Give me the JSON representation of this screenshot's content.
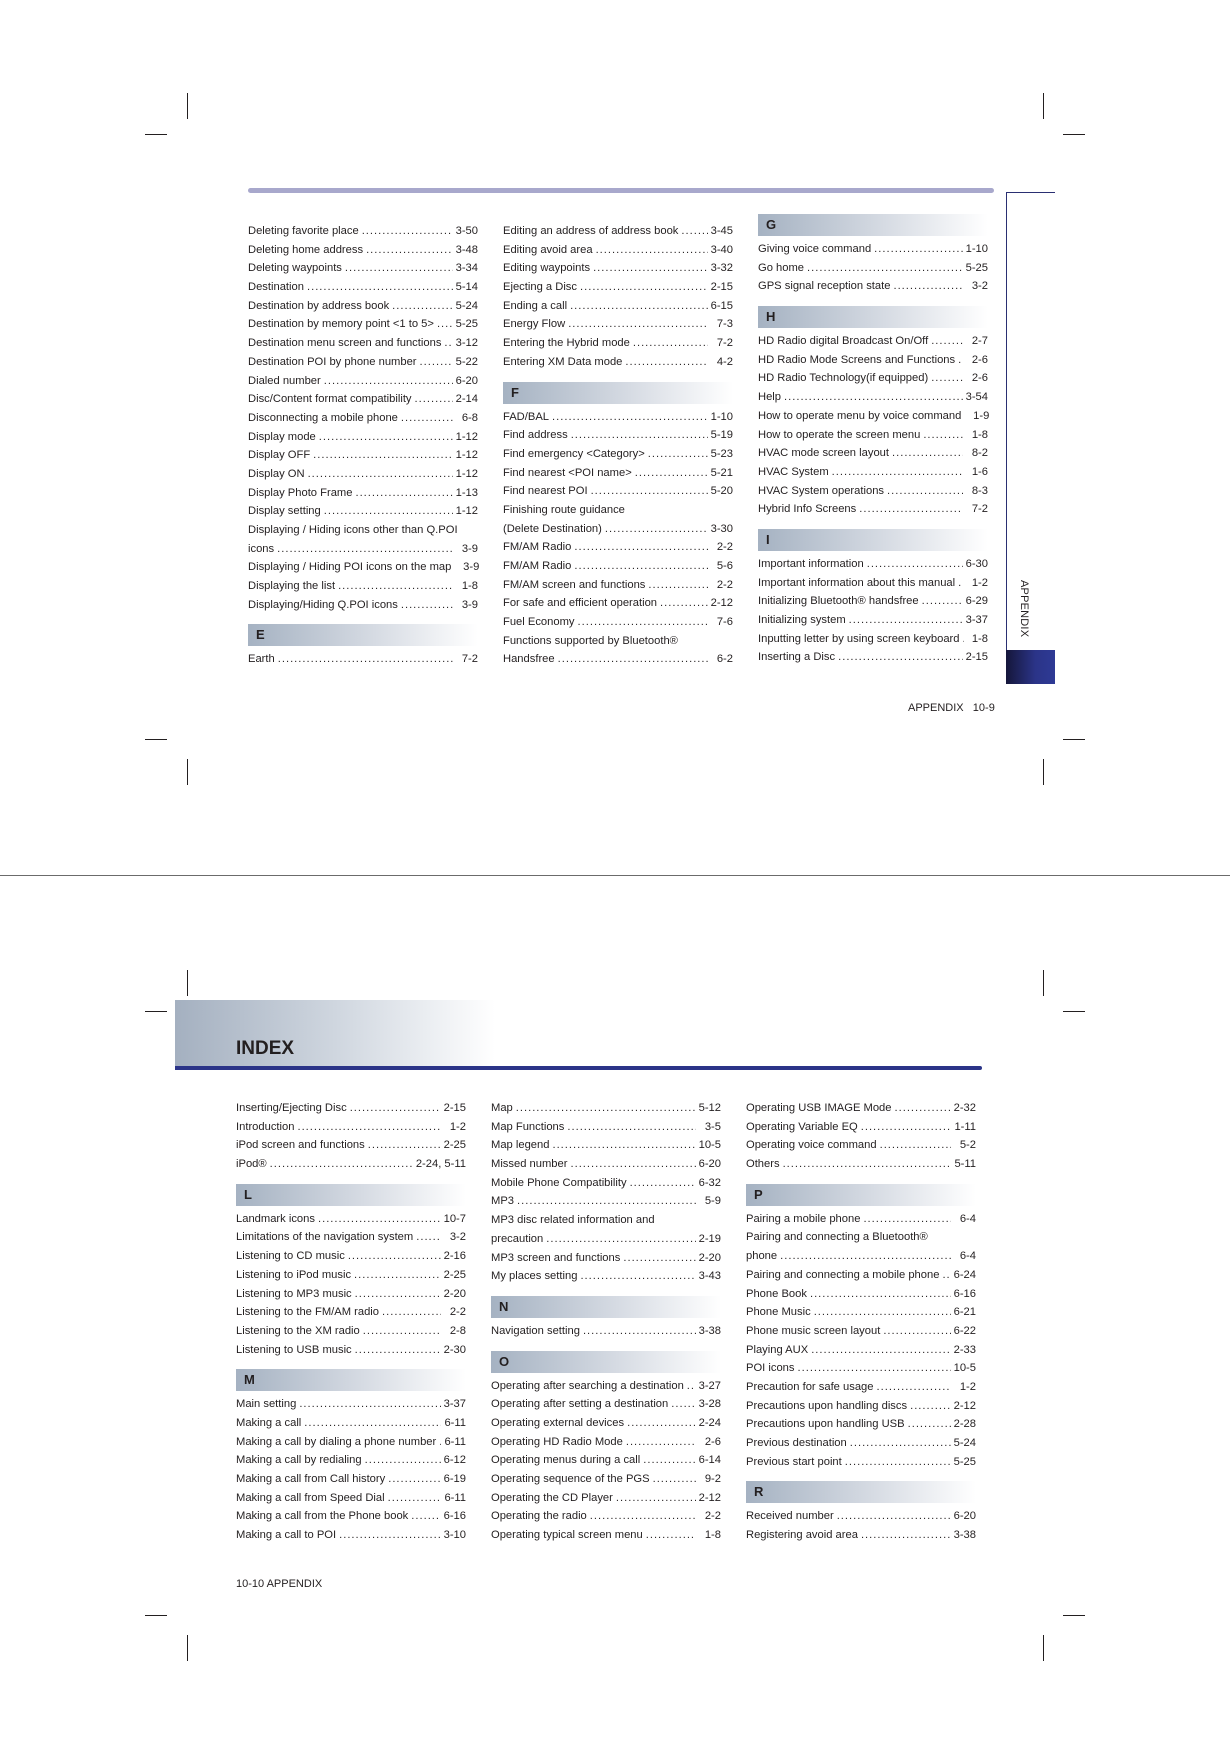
{
  "top_page": {
    "tab_label": "APPENDIX",
    "footer": "APPENDIX   10-9",
    "columns": [
      {
        "blocks": [
          {
            "entries": [
              {
                "t": "Deleting favorite place",
                "p": "3-50"
              },
              {
                "t": "Deleting home address",
                "p": "3-48"
              },
              {
                "t": "Deleting waypoints",
                "p": "3-34"
              },
              {
                "t": "Destination",
                "p": "5-14"
              },
              {
                "t": "Destination by address book",
                "p": "5-24"
              },
              {
                "t": "Destination by memory point <1 to 5>",
                "p": "5-25"
              },
              {
                "t": "Destination menu screen and functions",
                "p": "3-12"
              },
              {
                "t": "Destination POI by phone number",
                "p": "5-22"
              },
              {
                "t": "Dialed number",
                "p": "6-20"
              },
              {
                "t": "Disc/Content format compatibility",
                "p": "2-14"
              },
              {
                "t": "Disconnecting a mobile phone",
                "p": "6-8"
              },
              {
                "t": "Display mode",
                "p": "1-12"
              },
              {
                "t": "Display OFF",
                "p": "1-12"
              },
              {
                "t": "Display ON",
                "p": "1-12"
              },
              {
                "t": "Display Photo Frame",
                "p": "1-13"
              },
              {
                "t": "Display setting",
                "p": "1-12"
              },
              {
                "t": "Displaying / Hiding icons other than Q.POI",
                "p": ""
              },
              {
                "t": "icons",
                "p": "3-9"
              },
              {
                "t": "Displaying / Hiding POI icons on the map",
                "p": "3-9"
              },
              {
                "t": "Displaying the list",
                "p": "1-8"
              },
              {
                "t": "Displaying/Hiding Q.POI icons",
                "p": "3-9"
              }
            ]
          },
          {
            "letter": "E",
            "entries": [
              {
                "t": "Earth",
                "p": "7-2"
              }
            ]
          }
        ]
      },
      {
        "blocks": [
          {
            "entries": [
              {
                "t": "Editing an address of address book",
                "p": "3-45"
              },
              {
                "t": "Editing avoid area",
                "p": "3-40"
              },
              {
                "t": "Editing waypoints",
                "p": "3-32"
              },
              {
                "t": "Ejecting a Disc",
                "p": "2-15"
              },
              {
                "t": "Ending a call",
                "p": "6-15"
              },
              {
                "t": "Energy Flow",
                "p": "7-3"
              },
              {
                "t": "Entering the Hybrid mode",
                "p": "7-2"
              },
              {
                "t": "Entering XM Data mode",
                "p": "4-2"
              }
            ]
          },
          {
            "letter": "F",
            "entries": [
              {
                "t": "FAD/BAL",
                "p": "1-10"
              },
              {
                "t": "Find address",
                "p": "5-19"
              },
              {
                "t": "Find emergency <Category>",
                "p": "5-23"
              },
              {
                "t": "Find nearest <POI name>",
                "p": "5-21"
              },
              {
                "t": "Find nearest POI",
                "p": "5-20"
              },
              {
                "t": "Finishing route guidance",
                "p": ""
              },
              {
                "t": "(Delete Destination)",
                "p": "3-30"
              },
              {
                "t": "FM/AM Radio",
                "p": "2-2"
              },
              {
                "t": "FM/AM Radio",
                "p": "5-6"
              },
              {
                "t": "FM/AM screen and functions",
                "p": "2-2"
              },
              {
                "t": "For safe and efficient operation",
                "p": "2-12"
              },
              {
                "t": "Fuel Economy",
                "p": "7-6"
              },
              {
                "t": "Functions supported by Bluetooth®",
                "p": ""
              },
              {
                "t": "Handsfree",
                "p": "6-2"
              }
            ]
          }
        ]
      },
      {
        "blocks": [
          {
            "letter": "G",
            "entries": [
              {
                "t": "Giving voice command",
                "p": "1-10"
              },
              {
                "t": "Go home",
                "p": "5-25"
              },
              {
                "t": "GPS signal reception state",
                "p": "3-2"
              }
            ]
          },
          {
            "letter": "H",
            "entries": [
              {
                "t": "HD Radio digital Broadcast On/Off",
                "p": "2-7"
              },
              {
                "t": "HD Radio Mode Screens and Functions",
                "p": "2-6"
              },
              {
                "t": "HD Radio Technology(if equipped)",
                "p": "2-6"
              },
              {
                "t": "Help",
                "p": "3-54"
              },
              {
                "t": "How to operate menu by voice command",
                "p": "1-9"
              },
              {
                "t": "How to operate the screen menu",
                "p": "1-8"
              },
              {
                "t": "HVAC mode screen layout",
                "p": "8-2"
              },
              {
                "t": "HVAC System",
                "p": "1-6"
              },
              {
                "t": "HVAC System operations",
                "p": "8-3"
              },
              {
                "t": "Hybrid Info Screens",
                "p": "7-2"
              }
            ]
          },
          {
            "letter": "I",
            "entries": [
              {
                "t": "Important information",
                "p": "6-30"
              },
              {
                "t": "Important information about this manual",
                "p": "1-2"
              },
              {
                "t": "Initializing Bluetooth® handsfree",
                "p": "6-29"
              },
              {
                "t": "Initializing system",
                "p": "3-37"
              },
              {
                "t": "Inputting letter by using screen keyboard",
                "p": "1-8"
              },
              {
                "t": "Inserting a Disc",
                "p": "2-15"
              }
            ]
          }
        ]
      }
    ]
  },
  "bottom_page": {
    "title": "INDEX",
    "footer": "10-10 APPENDIX",
    "columns": [
      {
        "blocks": [
          {
            "entries": [
              {
                "t": "Inserting/Ejecting Disc",
                "p": "2-15"
              },
              {
                "t": "Introduction",
                "p": "1-2"
              },
              {
                "t": "iPod screen and functions",
                "p": "2-25"
              },
              {
                "t": "iPod®",
                "p": "2-24, 5-11"
              }
            ]
          },
          {
            "letter": "L",
            "entries": [
              {
                "t": "Landmark icons",
                "p": "10-7"
              },
              {
                "t": "Limitations of the navigation system",
                "p": "3-2"
              },
              {
                "t": "Listening to CD music",
                "p": "2-16"
              },
              {
                "t": "Listening to iPod music",
                "p": "2-25"
              },
              {
                "t": "Listening to MP3 music",
                "p": "2-20"
              },
              {
                "t": "Listening to the FM/AM radio",
                "p": "2-2"
              },
              {
                "t": "Listening to the XM radio",
                "p": "2-8"
              },
              {
                "t": "Listening to USB music",
                "p": "2-30"
              }
            ]
          },
          {
            "letter": "M",
            "entries": [
              {
                "t": "Main setting",
                "p": "3-37"
              },
              {
                "t": "Making a call",
                "p": "6-11"
              },
              {
                "t": "Making a call by dialing a phone number",
                "p": "6-11"
              },
              {
                "t": "Making a call by redialing",
                "p": "6-12"
              },
              {
                "t": "Making a call from Call history",
                "p": "6-19"
              },
              {
                "t": "Making a call from Speed Dial",
                "p": "6-11"
              },
              {
                "t": "Making a call from the Phone book",
                "p": "6-16"
              },
              {
                "t": "Making a call to POI",
                "p": "3-10"
              }
            ]
          }
        ]
      },
      {
        "blocks": [
          {
            "entries": [
              {
                "t": "Map",
                "p": "5-12"
              },
              {
                "t": "Map Functions",
                "p": "3-5"
              },
              {
                "t": "Map legend",
                "p": "10-5"
              },
              {
                "t": "Missed number",
                "p": "6-20"
              },
              {
                "t": "Mobile Phone Compatibility",
                "p": "6-32"
              },
              {
                "t": "MP3",
                "p": "5-9"
              },
              {
                "t": "MP3 disc related information and",
                "p": ""
              },
              {
                "t": "precaution",
                "p": "2-19"
              },
              {
                "t": "MP3 screen and functions",
                "p": "2-20"
              },
              {
                "t": "My places setting",
                "p": "3-43"
              }
            ]
          },
          {
            "letter": "N",
            "entries": [
              {
                "t": "Navigation setting",
                "p": "3-38"
              }
            ]
          },
          {
            "letter": "O",
            "entries": [
              {
                "t": "Operating after searching a destination",
                "p": "3-27"
              },
              {
                "t": "Operating after setting a destination",
                "p": "3-28"
              },
              {
                "t": "Operating external devices",
                "p": "2-24"
              },
              {
                "t": "Operating HD Radio Mode",
                "p": "2-6"
              },
              {
                "t": "Operating menus during a call",
                "p": "6-14"
              },
              {
                "t": "Operating sequence of the PGS",
                "p": "9-2"
              },
              {
                "t": "Operating the CD Player",
                "p": "2-12"
              },
              {
                "t": "Operating the radio",
                "p": "2-2"
              },
              {
                "t": "Operating typical screen menu",
                "p": "1-8"
              }
            ]
          }
        ]
      },
      {
        "blocks": [
          {
            "entries": [
              {
                "t": "Operating USB IMAGE Mode",
                "p": "2-32"
              },
              {
                "t": "Operating Variable EQ",
                "p": "1-11"
              },
              {
                "t": "Operating voice command",
                "p": "5-2"
              },
              {
                "t": "Others",
                "p": "5-11"
              }
            ]
          },
          {
            "letter": "P",
            "entries": [
              {
                "t": "Pairing a mobile phone",
                "p": "6-4"
              },
              {
                "t": "Pairing and connecting a Bluetooth®",
                "p": ""
              },
              {
                "t": "phone",
                "p": "6-4"
              },
              {
                "t": "Pairing and connecting a mobile phone",
                "p": "6-24"
              },
              {
                "t": "Phone Book",
                "p": "6-16"
              },
              {
                "t": "Phone Music",
                "p": "6-21"
              },
              {
                "t": "Phone music screen layout",
                "p": "6-22"
              },
              {
                "t": "Playing AUX",
                "p": "2-33"
              },
              {
                "t": "POI icons",
                "p": "10-5"
              },
              {
                "t": "Precaution for safe usage",
                "p": "1-2"
              },
              {
                "t": "Precautions upon handling discs",
                "p": "2-12"
              },
              {
                "t": "Precautions upon handling USB",
                "p": "2-28"
              },
              {
                "t": "Previous destination",
                "p": "5-24"
              },
              {
                "t": "Previous start point",
                "p": "5-25"
              }
            ]
          },
          {
            "letter": "R",
            "entries": [
              {
                "t": "Received number",
                "p": "6-20"
              },
              {
                "t": "Registering avoid area",
                "p": "3-38"
              }
            ]
          }
        ]
      }
    ]
  }
}
